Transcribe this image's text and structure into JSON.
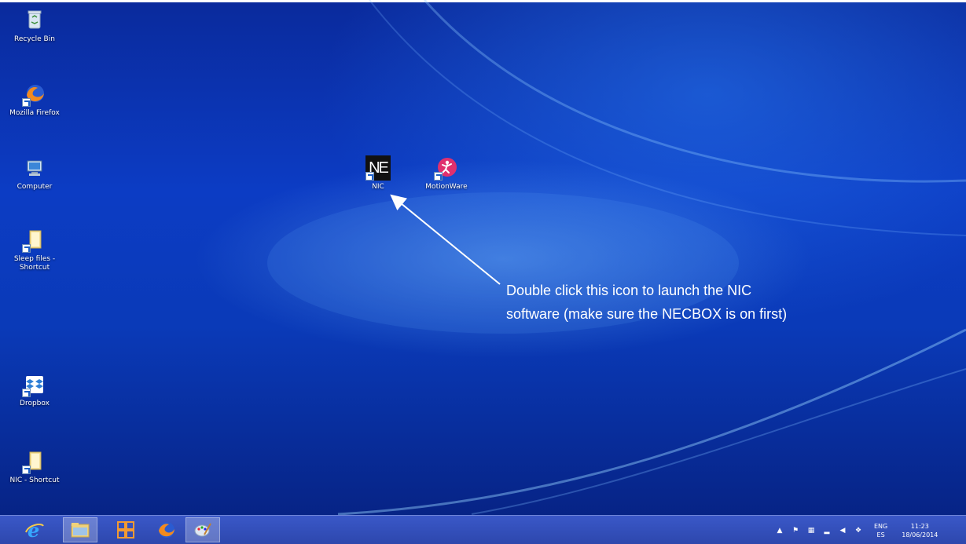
{
  "desktop_icons": {
    "recycle_bin": "Recycle Bin",
    "firefox": "Mozilla Firefox",
    "computer": "Computer",
    "sleep_files_1": "Sleep files -",
    "sleep_files_2": "Shortcut",
    "dropbox": "Dropbox",
    "nic_shortcut": "NIC - Shortcut",
    "nic": "NIC",
    "nic_glyph": "NE",
    "motionware": "MotionWare"
  },
  "annotation": {
    "line1": "Double click this icon to launch the NIC",
    "line2": "software (make sure the NECBOX is on first)"
  },
  "taskbar": {
    "apps": [
      "internet-explorer-icon",
      "file-explorer-icon",
      "office-icon",
      "firefox-icon",
      "paint-icon"
    ],
    "tray": {
      "language_top": "ENG",
      "language_bottom": "ES",
      "time": "11:23",
      "date": "18/06/2014"
    }
  },
  "colors": {
    "wallpaper_dark": "#06207e",
    "wallpaper_mid": "#0c3cc4",
    "taskbar": "#2d47ad",
    "text": "#ffffff"
  }
}
